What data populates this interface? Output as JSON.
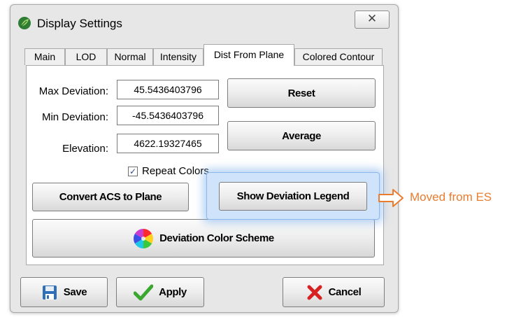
{
  "window": {
    "title": "Display Settings",
    "close_glyph": "✕"
  },
  "tabs": [
    {
      "label": "Main"
    },
    {
      "label": "LOD"
    },
    {
      "label": "Normal"
    },
    {
      "label": "Intensity"
    },
    {
      "label": "Dist From Plane",
      "active": true
    },
    {
      "label": "Colored Contour"
    }
  ],
  "fields": {
    "max_deviation": {
      "label": "Max Deviation:",
      "value": "45.5436403796"
    },
    "min_deviation": {
      "label": "Min Deviation:",
      "value": "-45.5436403796"
    },
    "elevation": {
      "label": "Elevation:",
      "value": "4622.19327465"
    }
  },
  "repeat_colors": {
    "label": "Repeat Colors",
    "checked": true
  },
  "buttons": {
    "reset": "Reset",
    "average": "Average",
    "convert_acs": "Convert ACS to Plane",
    "show_legend": "Show Deviation Legend",
    "color_scheme": "Deviation Color Scheme",
    "save": "Save",
    "apply": "Apply",
    "cancel": "Cancel"
  },
  "annotation": {
    "text": "Moved from ES",
    "color": "#e97c2f"
  },
  "icons": {
    "app": "leaf-icon",
    "close": "close-icon",
    "checkbox": "checkmark-icon",
    "color_wheel": "color-wheel-icon",
    "save": "floppy-disk-icon",
    "apply": "green-checkmark-icon",
    "cancel": "red-x-icon",
    "arrow": "arrow-right-icon"
  }
}
